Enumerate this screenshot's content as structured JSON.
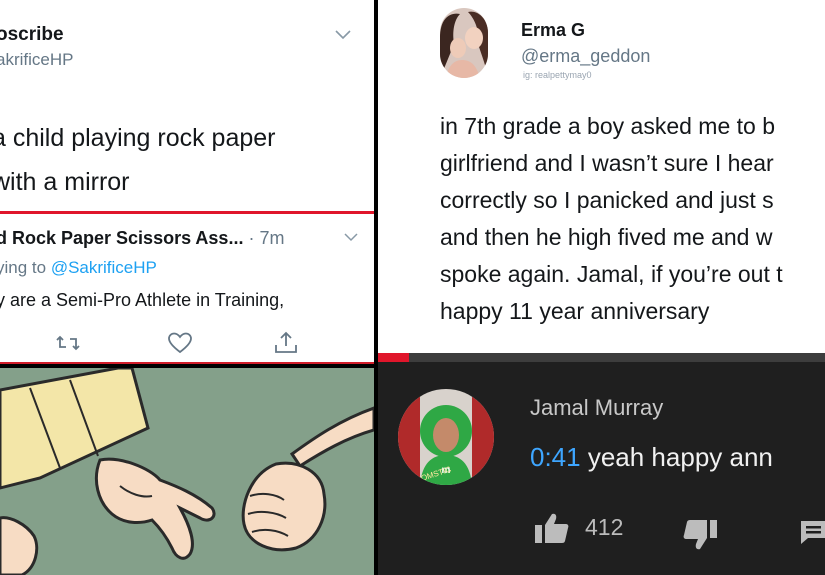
{
  "tweet1": {
    "author_name": "oscribe",
    "author_handle": "akrificeHP",
    "text_line1": "a child playing rock paper",
    "text_line2": "with a mirror",
    "reply": {
      "account": "d Rock Paper Scissors Ass...",
      "time": " · 7m",
      "replying_prefix": "ying to ",
      "replying_handle": "@SakrificeHP",
      "text": "y are a Semi-Pro Athlete in Training,"
    },
    "actions": [
      "retweet-icon",
      "like-icon",
      "share-icon"
    ]
  },
  "tweet2": {
    "name": "Erma G",
    "handle": "@erma_geddon",
    "ig_caption": "ig: realpettymay0",
    "lines": [
      "in 7th grade a boy asked me to b",
      "girlfriend and I wasn’t sure I hear",
      "correctly so I panicked and just s",
      "and then he high fived me and w",
      "spoke again. Jamal, if you’re out t",
      "happy 11 year anniversary"
    ]
  },
  "video_progress": 0.07,
  "comment": {
    "author": "Jamal Murray",
    "timestamp": "0:41",
    "text": " yeah happy ann",
    "likes": "412",
    "avatar_caption": "OMSTIC"
  },
  "colors": {
    "twitter_blue": "#1da1f2",
    "youtube_red": "#e0162b",
    "youtube_bg": "#1f1f1f",
    "timestamp_blue": "#3ea6ff",
    "cartoon_bg": "#84a08a"
  }
}
